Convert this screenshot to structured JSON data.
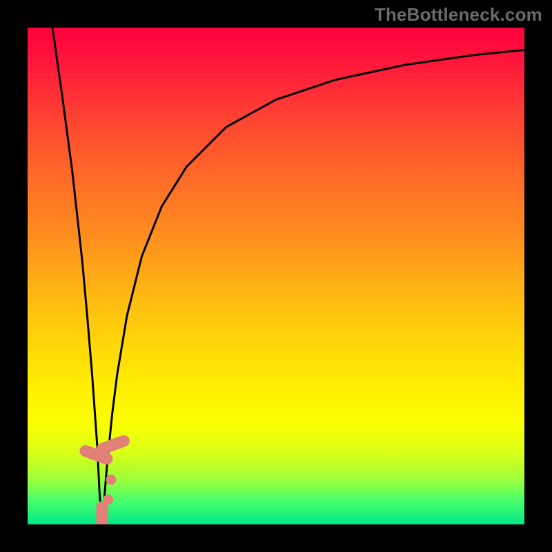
{
  "watermark": "TheBottleneck.com",
  "colors": {
    "frame": "#000000",
    "curve": "#000000",
    "marker": "#e28078"
  },
  "chart_data": {
    "type": "line",
    "title": "",
    "xlabel": "",
    "ylabel": "",
    "xlim": [
      0,
      100
    ],
    "ylim": [
      0,
      100
    ],
    "grid": false,
    "series": [
      {
        "name": "left-branch",
        "x": [
          5,
          7,
          9,
          11,
          12,
          13,
          14,
          14.5,
          15
        ],
        "y": [
          100,
          86,
          71,
          53,
          42,
          30,
          16,
          6,
          0
        ]
      },
      {
        "name": "right-branch",
        "x": [
          15,
          16,
          17,
          18,
          20,
          23,
          27,
          32,
          40,
          50,
          62,
          76,
          90,
          100
        ],
        "y": [
          0,
          12,
          22,
          30,
          42,
          54,
          64,
          72,
          80,
          85.5,
          89.5,
          92.5,
          94.5,
          95.5
        ]
      }
    ],
    "markers": [
      {
        "shape": "pill",
        "x": 13.8,
        "y": 14,
        "angle": -70
      },
      {
        "shape": "pill",
        "x": 17.2,
        "y": 16,
        "angle": 70
      },
      {
        "shape": "dot",
        "x": 16.8,
        "y": 9
      },
      {
        "shape": "dot",
        "x": 16.2,
        "y": 5
      },
      {
        "shape": "pill",
        "x": 15.0,
        "y": 1.2,
        "angle": 0
      }
    ],
    "min_x": 15
  }
}
